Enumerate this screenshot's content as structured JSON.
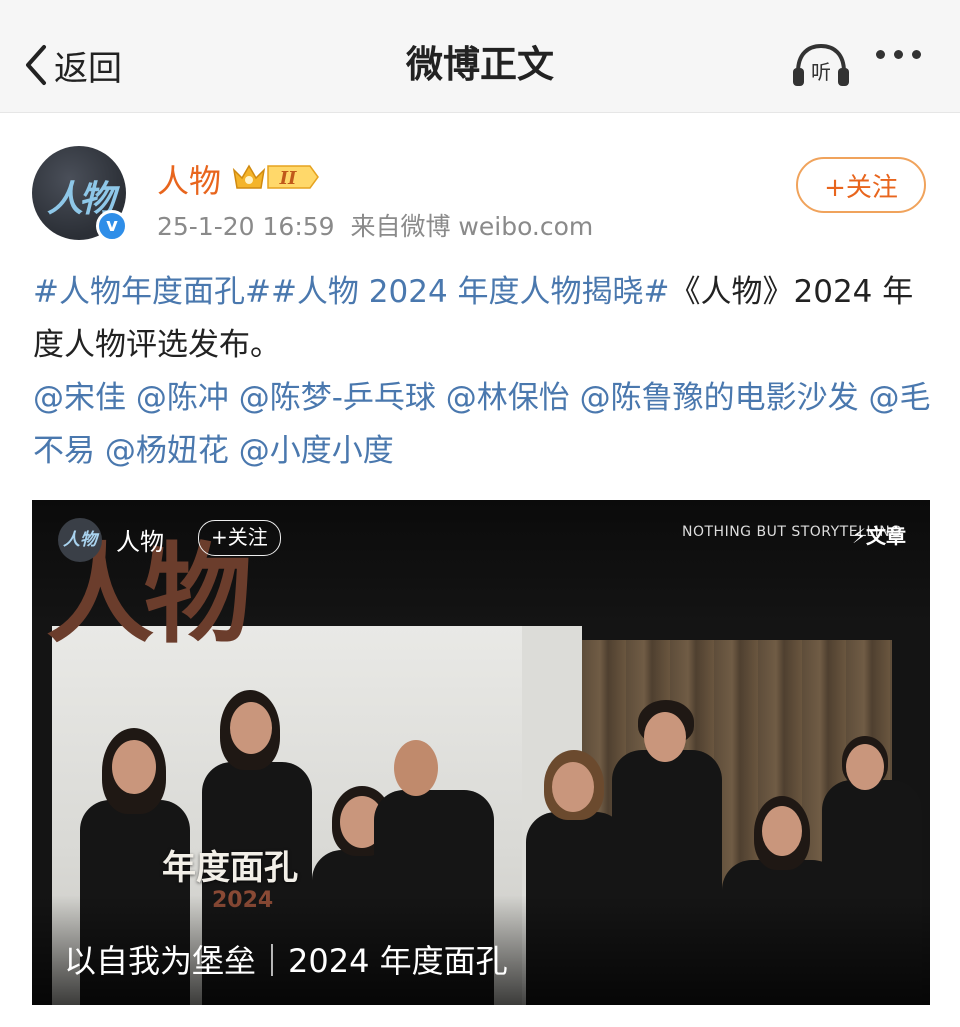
{
  "nav": {
    "back_label": "返回",
    "title": "微博正文",
    "listen_label": "听"
  },
  "post": {
    "username": "人物",
    "avatar_text": "人物",
    "time": "25-1-20 16:59",
    "source": "来自微博 weibo.com",
    "follow_label": "+关注",
    "hashtag1": "#人物年度面孔#",
    "hashtag2": "#人物 2024 年度人物揭晓#",
    "body_text": "《人物》2024 年度人物评选发布。",
    "mentions": [
      "@宋佳",
      "@陈冲",
      "@陈梦-乒乓球",
      "@林保怡",
      "@陈鲁豫的电影沙发",
      "@毛不易",
      "@杨妞花",
      "@小度小度"
    ]
  },
  "media": {
    "big_title": "人物",
    "account_avatar": "人物",
    "account_name": "人物",
    "follow_label": "+关注",
    "slogan": "NOTHING BUT STORYTELLING",
    "badge": "⚡文章",
    "face_label": "年度面孔",
    "year_label": "2024",
    "caption": "以自我为堡垒｜2024 年度面孔"
  },
  "colors": {
    "link": "#4a78ae",
    "username": "#e8651d",
    "follow_border": "#f0a35c"
  }
}
